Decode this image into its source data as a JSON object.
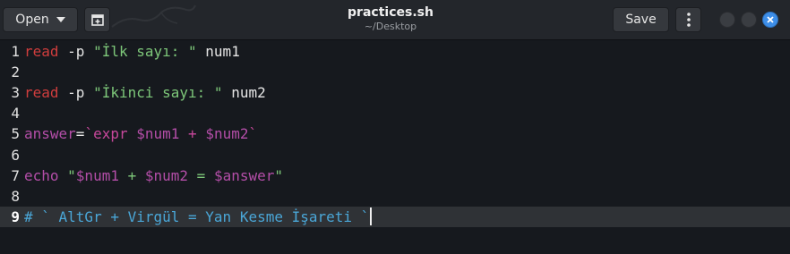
{
  "header": {
    "open_label": "Open",
    "save_label": "Save",
    "title": "practices.sh",
    "subtitle": "~/Desktop"
  },
  "colors": {
    "keyword": "#cf3d3d",
    "string": "#7ec87a",
    "variable": "#b44ea8",
    "comment": "#4aa7d8",
    "close_button": "#3d8ee8"
  },
  "icons": {
    "open_dropdown": "chevron-down-icon",
    "new_tab": "new-document-icon",
    "menu": "vertical-dots-icon",
    "minimize": "minimize-icon",
    "maximize": "maximize-icon",
    "close": "close-icon"
  },
  "editor": {
    "current_line": 9,
    "lines": [
      {
        "num": "1",
        "segments": [
          {
            "t": "read",
            "c": "kw"
          },
          {
            "t": " -p ",
            "c": "plain"
          },
          {
            "t": "\"İlk sayı: \"",
            "c": "str"
          },
          {
            "t": " num1",
            "c": "plain"
          }
        ]
      },
      {
        "num": "2",
        "segments": []
      },
      {
        "num": "3",
        "segments": [
          {
            "t": "read",
            "c": "kw"
          },
          {
            "t": " -p ",
            "c": "plain"
          },
          {
            "t": "\"İkinci sayı: \"",
            "c": "str"
          },
          {
            "t": " num2",
            "c": "plain"
          }
        ]
      },
      {
        "num": "4",
        "segments": []
      },
      {
        "num": "5",
        "segments": [
          {
            "t": "answer",
            "c": "var"
          },
          {
            "t": "=",
            "c": "plain"
          },
          {
            "t": "`expr ",
            "c": "sub"
          },
          {
            "t": "$num1",
            "c": "var"
          },
          {
            "t": " + ",
            "c": "sub"
          },
          {
            "t": "$num2",
            "c": "var"
          },
          {
            "t": "`",
            "c": "sub"
          }
        ]
      },
      {
        "num": "6",
        "segments": []
      },
      {
        "num": "7",
        "segments": [
          {
            "t": "echo",
            "c": "var"
          },
          {
            "t": " \"",
            "c": "str"
          },
          {
            "t": "$num1",
            "c": "var"
          },
          {
            "t": " + ",
            "c": "str"
          },
          {
            "t": "$num2",
            "c": "var"
          },
          {
            "t": " = ",
            "c": "str"
          },
          {
            "t": "$answer",
            "c": "var"
          },
          {
            "t": "\"",
            "c": "str"
          }
        ]
      },
      {
        "num": "8",
        "segments": []
      },
      {
        "num": "9",
        "segments": [
          {
            "t": "# ` AltGr + Virgül = Yan Kesme İşareti `",
            "c": "cmt"
          }
        ]
      }
    ]
  }
}
